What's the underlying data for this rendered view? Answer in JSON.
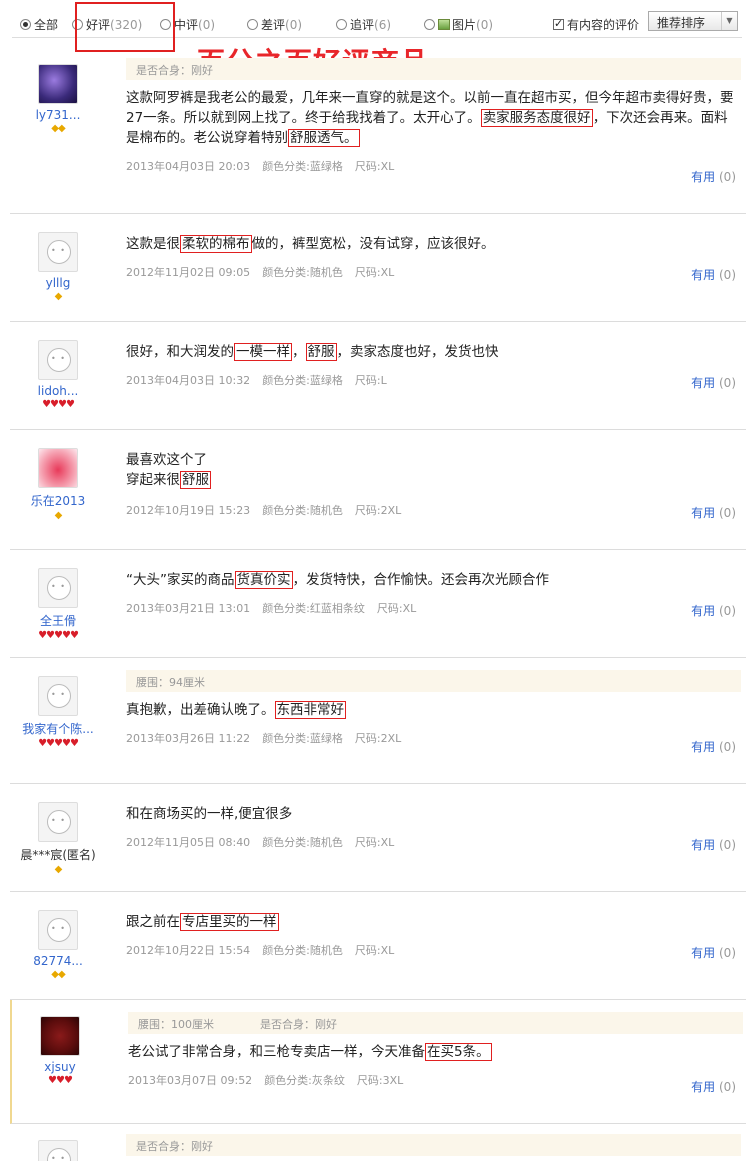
{
  "filters": {
    "all": "全部",
    "good": "好评",
    "good_count": "(320)",
    "mid": "中评",
    "mid_count": "(0)",
    "bad": "差评",
    "bad_count": "(0)",
    "follow": "追评",
    "follow_count": "(6)",
    "pic": "图片",
    "pic_count": "(0)",
    "has_content": "有内容的评价",
    "sort": "推荐排序"
  },
  "banner": "百分之百好评商品",
  "useful_label": "有用",
  "useful_count": "(0)",
  "reviews": [
    {
      "user": "ly731...",
      "meta": [
        "是否合身：刚好"
      ],
      "text_parts": [
        "这款阿罗裤是我老公的最爱，几年来一直穿的就是这个。以前一直在超市买，但今年超市卖得好贵，要27一条。所以就到网上找了。终于给我找着了。太开心了。",
        "卖家服务态度很好",
        "，下次还会再来。面料是棉布的。老公说穿着特别",
        "舒服透气。"
      ],
      "date": "2013年04月03日 20:03",
      "color": "颜色分类:蓝绿格",
      "size": "尺码:XL"
    },
    {
      "user": "ylllg",
      "text_parts": [
        "这款是很",
        "柔软的棉布",
        "做的，裤型宽松，没有试穿，应该很好。"
      ],
      "date": "2012年11月02日 09:05",
      "color": "颜色分类:随机色",
      "size": "尺码:XL"
    },
    {
      "user": "lidoh...",
      "text_parts": [
        "很好，和大润发的",
        "一模一样",
        "，",
        "舒服",
        "，卖家态度也好，发货也快"
      ],
      "date": "2013年04月03日 10:32",
      "color": "颜色分类:蓝绿格",
      "size": "尺码:L"
    },
    {
      "user": "乐在2013",
      "text_parts": [
        "最喜欢这个了",
        "穿起来很",
        "舒服"
      ],
      "date": "2012年10月19日 15:23",
      "color": "颜色分类:随机色",
      "size": "尺码:2XL"
    },
    {
      "user": "全王傦",
      "text_parts": [
        "“大头”家买的商品",
        "货真价实",
        "，发货特快，合作愉快。还会再次光顾合作"
      ],
      "date": "2013年03月21日 13:01",
      "color": "颜色分类:红蓝相条纹",
      "size": "尺码:XL"
    },
    {
      "user": "我家有个陈...",
      "meta": [
        "腰围：94厘米"
      ],
      "text_parts": [
        "真抱歉，出差确认晚了。",
        "东西非常好"
      ],
      "date": "2013年03月26日 11:22",
      "color": "颜色分类:蓝绿格",
      "size": "尺码:2XL"
    },
    {
      "user": "晨***宸(匿名)",
      "text_parts": [
        "和在商场买的一样,便宜很多"
      ],
      "date": "2012年11月05日 08:40",
      "color": "颜色分类:随机色",
      "size": "尺码:XL"
    },
    {
      "user": "82774...",
      "text_parts": [
        "跟之前在",
        "专店里买的一样"
      ],
      "date": "2012年10月22日 15:54",
      "color": "颜色分类:随机色",
      "size": "尺码:XL"
    },
    {
      "user": "xjsuy",
      "meta": [
        "腰围：100厘米",
        "是否合身：刚好"
      ],
      "text_parts": [
        "老公试了非常合身，和三枪专卖店一样，今天准备",
        "在买5条。"
      ],
      "date": "2013年03月07日 09:52",
      "color": "颜色分类:灰条纹",
      "size": "尺码:3XL"
    },
    {
      "meta": [
        "是否合身：刚好"
      ]
    }
  ]
}
